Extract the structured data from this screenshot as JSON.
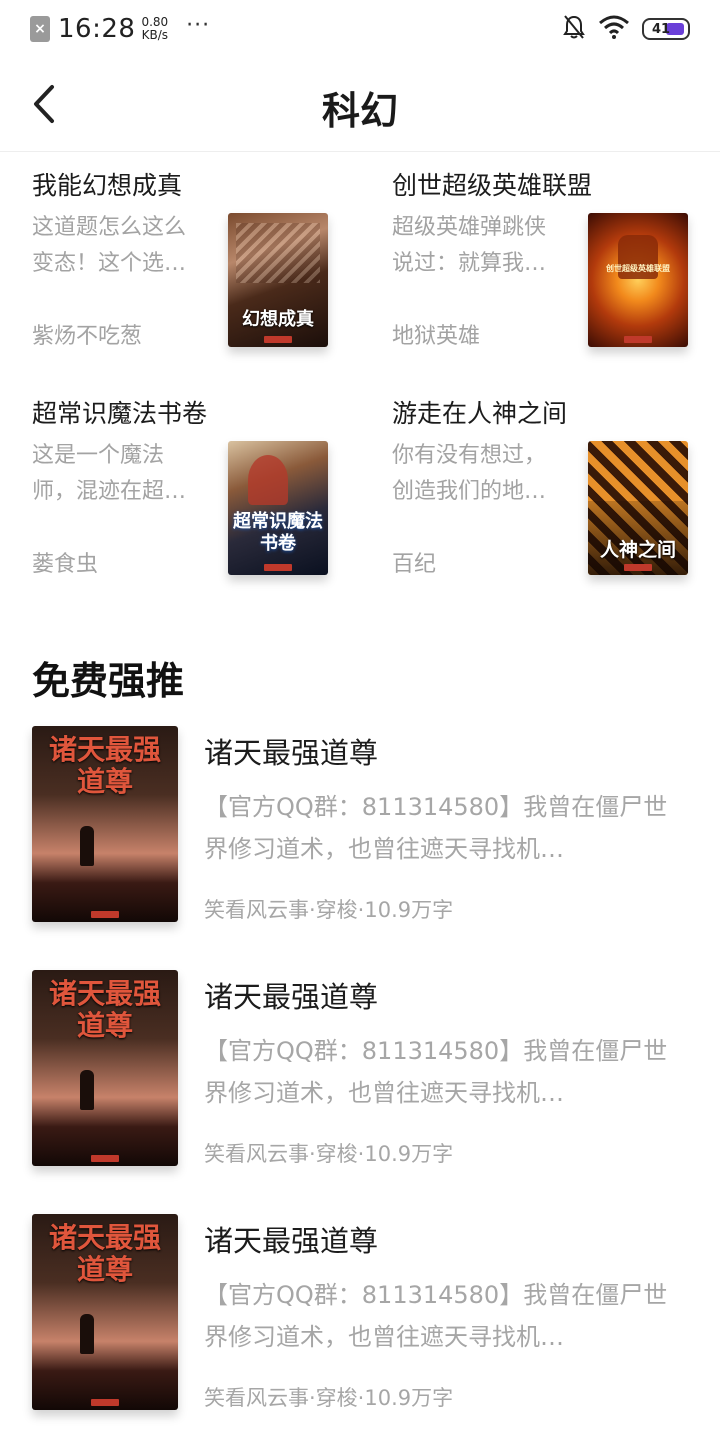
{
  "status_bar": {
    "time": "16:28",
    "speed_value": "0.80",
    "speed_unit": "KB/s",
    "more": "···",
    "battery": "41"
  },
  "nav": {
    "title": "科幻"
  },
  "grid_books": [
    {
      "title": "我能幻想成真",
      "desc": "这道题怎么这么变态！这个选…",
      "author": "紫炀不吃葱",
      "cover_text": "幻想成真"
    },
    {
      "title": "创世超级英雄联盟",
      "desc": "超级英雄弹跳侠说过：就算我…",
      "author": "地狱英雄",
      "cover_text": "创世超级英雄联盟"
    },
    {
      "title": "超常识魔法书卷",
      "desc": "这是一个魔法师，混迹在超…",
      "author": "蒌食虫",
      "cover_text": "超常识魔法书卷"
    },
    {
      "title": "游走在人神之间",
      "desc": "你有没有想过，创造我们的地…",
      "author": "百纪",
      "cover_text": "人神之间"
    }
  ],
  "section": {
    "title": "免费强推"
  },
  "push_books": [
    {
      "title": "诸天最强道尊",
      "desc": "【官方QQ群：811314580】我曾在僵尸世界修习道术，也曾往遮天寻找机…",
      "meta": "笑看风云事·穿梭·10.9万字",
      "cover_text": "诸天最强道尊"
    },
    {
      "title": "诸天最强道尊",
      "desc": "【官方QQ群：811314580】我曾在僵尸世界修习道术，也曾往遮天寻找机…",
      "meta": "笑看风云事·穿梭·10.9万字",
      "cover_text": "诸天最强道尊"
    },
    {
      "title": "诸天最强道尊",
      "desc": "【官方QQ群：811314580】我曾在僵尸世界修习道术，也曾往遮天寻找机…",
      "meta": "笑看风云事·穿梭·10.9万字",
      "cover_text": "诸天最强道尊"
    }
  ],
  "colors": {
    "battery_fill": "#6a3fd8",
    "muted_text": "#a3a3a3",
    "title_text": "#1c1c1c"
  }
}
